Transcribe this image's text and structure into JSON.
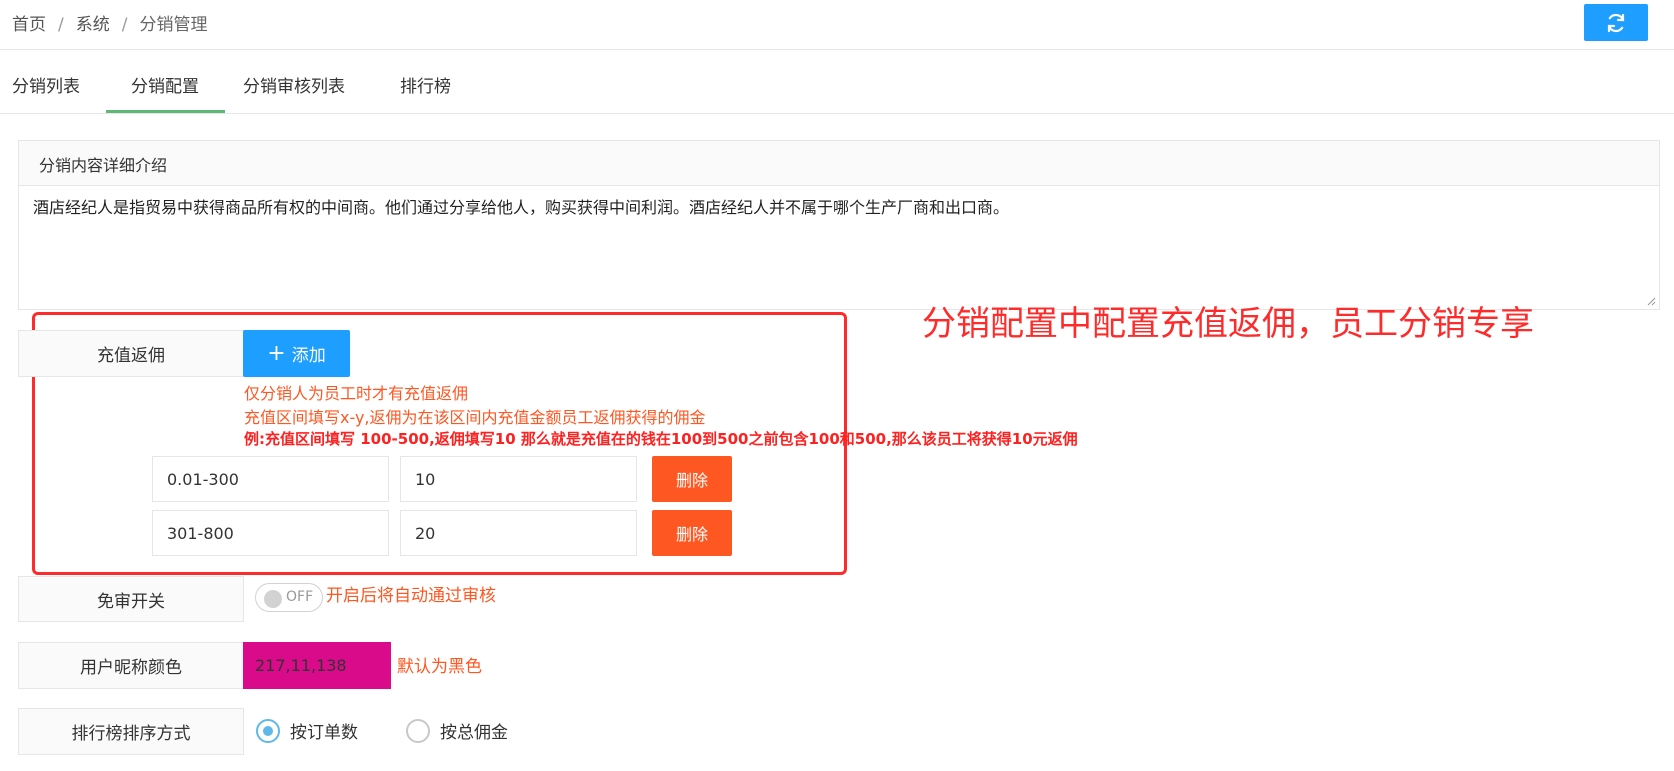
{
  "breadcrumb": {
    "home": "首页",
    "system": "系统",
    "current": "分销管理",
    "separator": "/"
  },
  "tabs": [
    {
      "label": "分销列表"
    },
    {
      "label": "分销配置"
    },
    {
      "label": "分销审核列表"
    },
    {
      "label": "排行榜"
    }
  ],
  "active_tab": "分销配置",
  "intro": {
    "title": "分销内容详细介绍",
    "content": "酒店经纪人是指贸易中获得商品所有权的中间商。他们通过分享给他人，购买获得中间利润。酒店经纪人并不属于哪个生产厂商和出口商。"
  },
  "annotation": {
    "text": "分销配置中配置充值返佣，员工分销专享",
    "color": "#ff2b2b"
  },
  "recharge": {
    "label": "充值返佣",
    "add_label": "添加",
    "tips": [
      "仅分销人为员工时才有充值返佣",
      "充值区间填写x-y,返佣为在该区间内充值金额员工返佣获得的佣金"
    ],
    "example": "例:充值区间填写 100-500,返佣填写10 那么就是充值在的钱在100到500之前包含100和500,那么该员工将获得10元返佣",
    "rows": [
      {
        "range": "0.01-300",
        "commission": "10",
        "delete_label": "删除"
      },
      {
        "range": "301-800",
        "commission": "20",
        "delete_label": "删除"
      }
    ]
  },
  "auto_approve": {
    "label": "免审开关",
    "state": "OFF",
    "tip": "开启后将自动通过审核"
  },
  "nickname_color": {
    "label": "用户昵称颜色",
    "value": "217,11,138",
    "hex": "#d90b8a",
    "tip": "默认为黑色"
  },
  "ranking": {
    "label": "排行榜排序方式",
    "options": [
      {
        "label": "按订单数",
        "checked": true
      },
      {
        "label": "按总佣金",
        "checked": false
      }
    ]
  },
  "colors": {
    "primary": "#1e9fff",
    "danger": "#ff5722",
    "tab_active": "#5fb878"
  }
}
